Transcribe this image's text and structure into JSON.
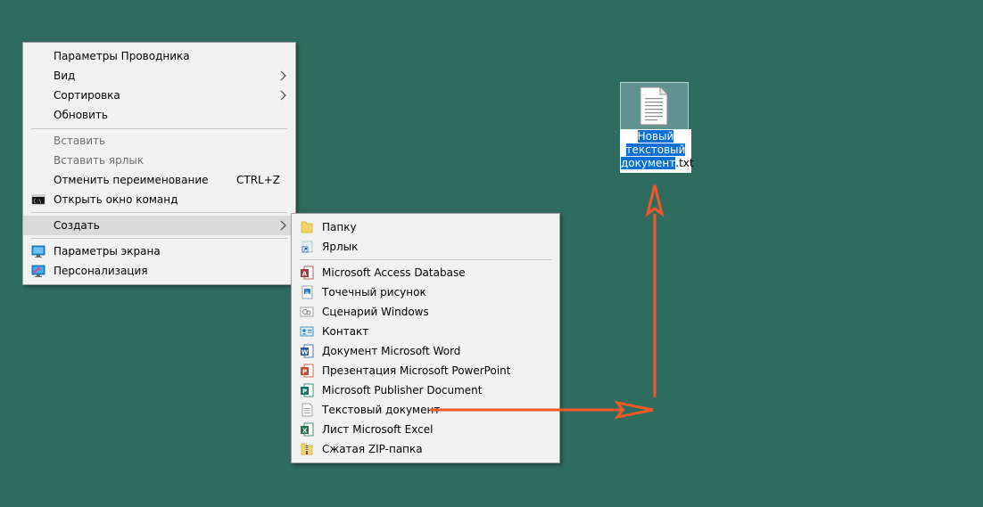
{
  "context_menu": {
    "items": [
      {
        "label": "Параметры Проводника"
      },
      {
        "label": "Вид"
      },
      {
        "label": "Сортировка"
      },
      {
        "label": "Обновить"
      },
      {
        "label": "Вставить"
      },
      {
        "label": "Вставить ярлык"
      },
      {
        "label": "Отменить переименование",
        "shortcut": "CTRL+Z"
      },
      {
        "label": "Открыть окно команд"
      },
      {
        "label": "Создать"
      },
      {
        "label": "Параметры экрана"
      },
      {
        "label": "Персонализация"
      }
    ]
  },
  "submenu_create": {
    "items": [
      {
        "label": "Папку",
        "icon": "folder-icon"
      },
      {
        "label": "Ярлык",
        "icon": "shortcut-icon"
      },
      {
        "label": "Microsoft Access Database",
        "icon": "access-icon"
      },
      {
        "label": "Точечный рисунок",
        "icon": "bitmap-icon"
      },
      {
        "label": "Сценарий Windows",
        "icon": "script-icon"
      },
      {
        "label": "Контакт",
        "icon": "contact-icon"
      },
      {
        "label": "Документ Microsoft Word",
        "icon": "word-icon"
      },
      {
        "label": "Презентация Microsoft PowerPoint",
        "icon": "powerpoint-icon"
      },
      {
        "label": "Microsoft Publisher Document",
        "icon": "publisher-icon"
      },
      {
        "label": "Текстовый документ",
        "icon": "text-document-icon"
      },
      {
        "label": "Лист Microsoft Excel",
        "icon": "excel-icon"
      },
      {
        "label": "Сжатая ZIP-папка",
        "icon": "zip-folder-icon"
      }
    ]
  },
  "desktop_file": {
    "name_line1": "Новый",
    "name_line2": "текстовый",
    "name_line3": "документ",
    "extension": ".txt"
  },
  "colors": {
    "desktop": "#2f6b5e",
    "annotation_arrow": "#f05a28",
    "selection": "#0a6fd6"
  }
}
